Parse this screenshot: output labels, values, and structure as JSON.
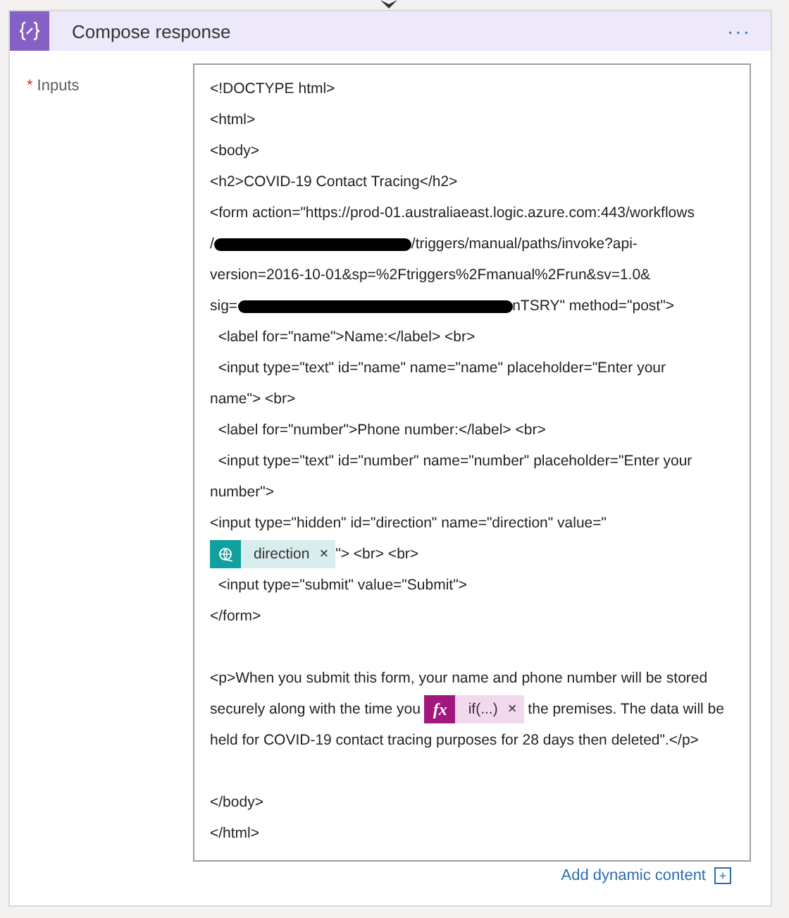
{
  "card": {
    "title": "Compose response",
    "more": "···"
  },
  "field": {
    "label": "Inputs",
    "required": "*",
    "lines": [
      {
        "kind": "text",
        "segments": [
          {
            "kind": "text",
            "text": "<!DOCTYPE html>"
          }
        ]
      },
      {
        "kind": "text",
        "segments": [
          {
            "kind": "text",
            "text": "<html>"
          }
        ]
      },
      {
        "kind": "text",
        "segments": [
          {
            "kind": "text",
            "text": "<body>"
          }
        ]
      },
      {
        "kind": "text",
        "segments": [
          {
            "kind": "text",
            "text": "<h2>COVID-19 Contact Tracing</h2>"
          }
        ]
      },
      {
        "kind": "text",
        "segments": [
          {
            "kind": "text",
            "text": "<form action=\"https://prod-01.australiaeast.logic.azure.com:443/workflows"
          }
        ]
      },
      {
        "kind": "text",
        "segments": [
          {
            "kind": "text",
            "text": "/"
          },
          {
            "kind": "redacted_long"
          },
          {
            "kind": "text",
            "text": "/triggers/manual/paths/invoke?api-"
          }
        ]
      },
      {
        "kind": "text",
        "segments": [
          {
            "kind": "text",
            "text": "version=2016-10-01&sp=%2Ftriggers%2Fmanual%2Frun&sv=1.0&"
          }
        ]
      },
      {
        "kind": "text",
        "segments": [
          {
            "kind": "text",
            "text": "sig="
          },
          {
            "kind": "redacted_xlong"
          },
          {
            "kind": "text",
            "text": "nTSRY\" method=\"post\">"
          }
        ]
      },
      {
        "kind": "text",
        "segments": [
          {
            "kind": "text",
            "text": "  <label for=\"name\">Name:</label> <br>"
          }
        ]
      },
      {
        "kind": "text",
        "segments": [
          {
            "kind": "text",
            "text": "  <input type=\"text\" id=\"name\" name=\"name\" placeholder=\"Enter your"
          }
        ]
      },
      {
        "kind": "text",
        "segments": [
          {
            "kind": "text",
            "text": "name\"> <br>"
          }
        ]
      },
      {
        "kind": "text",
        "segments": [
          {
            "kind": "text",
            "text": "  <label for=\"number\">Phone number:</label> <br>"
          }
        ]
      },
      {
        "kind": "text",
        "segments": [
          {
            "kind": "text",
            "text": "  <input type=\"text\" id=\"number\" name=\"number\" placeholder=\"Enter your"
          }
        ]
      },
      {
        "kind": "text",
        "segments": [
          {
            "kind": "text",
            "text": "number\">"
          }
        ]
      },
      {
        "kind": "text",
        "segments": [
          {
            "kind": "text",
            "text": "<input type=\"hidden\" id=\"direction\" name=\"direction\" value=\""
          }
        ]
      },
      {
        "kind": "text",
        "segments": [
          {
            "kind": "dynamic_token",
            "label": "direction",
            "remove": "×"
          },
          {
            "kind": "text",
            "text": "\"> <br> <br>"
          }
        ]
      },
      {
        "kind": "text",
        "segments": [
          {
            "kind": "text",
            "text": "  <input type=\"submit\" value=\"Submit\">"
          }
        ]
      },
      {
        "kind": "text",
        "segments": [
          {
            "kind": "text",
            "text": "</form>"
          }
        ]
      },
      {
        "kind": "blank"
      },
      {
        "kind": "text",
        "segments": [
          {
            "kind": "text",
            "text": "<p>When you submit this form, your name and phone number will be stored"
          }
        ]
      },
      {
        "kind": "text",
        "segments": [
          {
            "kind": "text",
            "text": "securely along with the time you "
          },
          {
            "kind": "expression_token",
            "icon": "fx",
            "label": "if(...)",
            "remove": "×"
          },
          {
            "kind": "text",
            "text": " the premises. The data will be"
          }
        ]
      },
      {
        "kind": "text",
        "segments": [
          {
            "kind": "text",
            "text": "held for COVID-19 contact tracing purposes for 28 days then deleted\".</p>"
          }
        ]
      },
      {
        "kind": "blank"
      },
      {
        "kind": "text",
        "segments": [
          {
            "kind": "text",
            "text": "</body>"
          }
        ]
      },
      {
        "kind": "text",
        "segments": [
          {
            "kind": "text",
            "text": "</html>"
          }
        ]
      }
    ]
  },
  "add_dynamic": {
    "label": "Add dynamic content",
    "icon": "+"
  }
}
